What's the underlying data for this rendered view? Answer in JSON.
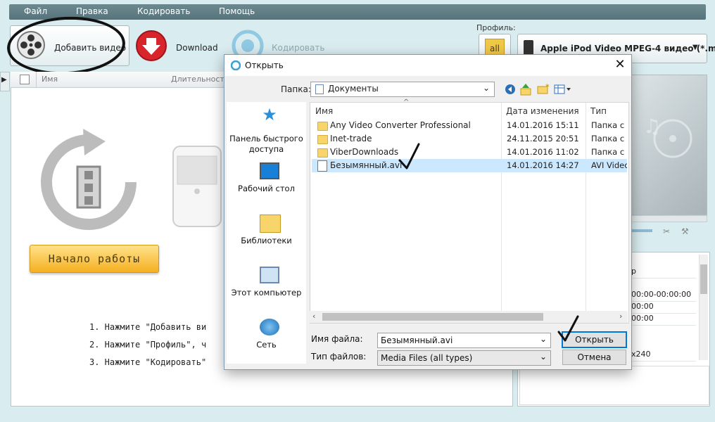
{
  "menu": [
    "Файл",
    "Правка",
    "Кодировать",
    "Помощь"
  ],
  "toolbar": {
    "add_video": "Добавить видео",
    "download": "Download",
    "encode": "Кодировать"
  },
  "profile": {
    "label": "Профиль:",
    "all_button": "all",
    "selected": "Apple iPod Video MPEG-4 видео (*.m..."
  },
  "list_header": {
    "name": "Имя",
    "duration": "Длительность"
  },
  "start_button": "Начало работы",
  "instructions": [
    "1. Нажмите \"Добавить ви",
    "2. Нажмите \"Профиль\", ч",
    "3. Нажмите \"Кодировать\""
  ],
  "properties": {
    "row1": "р",
    "row2": "00:00-00:00:00",
    "row3": "00:00",
    "row4": "00:00",
    "row5": "x240"
  },
  "dialog": {
    "title": "Открыть",
    "folder_label": "Папка:",
    "folder_value": "Документы",
    "nav": [
      {
        "label": "Панель быстрого доступа",
        "icon": "star-icon"
      },
      {
        "label": "Рабочий стол",
        "icon": "desktop-icon"
      },
      {
        "label": "Библиотеки",
        "icon": "libraries-icon"
      },
      {
        "label": "Этот компьютер",
        "icon": "computer-icon"
      },
      {
        "label": "Сеть",
        "icon": "network-icon"
      }
    ],
    "columns": {
      "name": "Имя",
      "date": "Дата изменения",
      "type": "Тип"
    },
    "files": [
      {
        "name": "Any Video Converter Professional",
        "date": "14.01.2016 15:11",
        "type": "Папка с файлами",
        "kind": "folder"
      },
      {
        "name": "Inet-trade",
        "date": "24.11.2015 20:51",
        "type": "Папка с файлами",
        "kind": "folder"
      },
      {
        "name": "ViberDownloads",
        "date": "14.01.2016 11:02",
        "type": "Папка с файлами",
        "kind": "folder"
      },
      {
        "name": "Безымянный.avi",
        "date": "14.01.2016 14:27",
        "type": "AVI Video",
        "kind": "avi"
      }
    ],
    "filename_label": "Имя файла:",
    "filename_value": "Безымянный.avi",
    "filetype_label": "Тип файлов:",
    "filetype_value": "Media Files (all types)",
    "open_button": "Открыть",
    "cancel_button": "Отмена"
  },
  "colors": {
    "menu_bar": "#5f7b83",
    "start_button": "#f5b021",
    "selected_row": "#cce8ff",
    "open_button_border": "#0078d7"
  }
}
